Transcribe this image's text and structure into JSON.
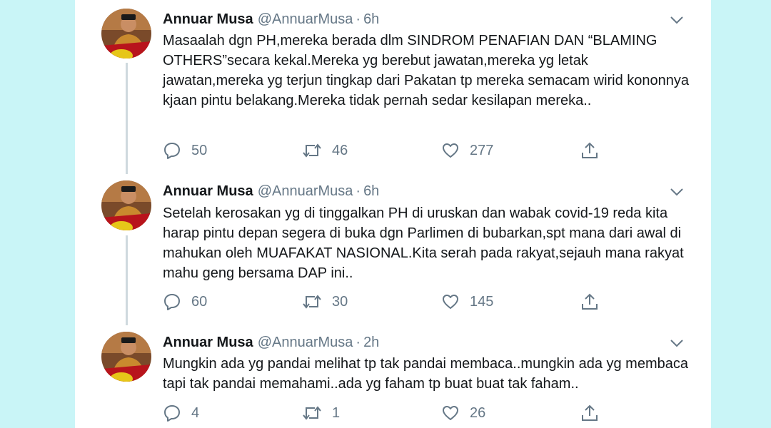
{
  "tweets": [
    {
      "name": "Annuar Musa",
      "handle": "@AnnuarMusa",
      "time": "6h",
      "text": "Masaalah dgn PH,mereka berada dlm SINDROM PENAFIAN DAN “BLAMING OTHERS”secara kekal.Mereka yg berebut jawatan,mereka yg letak jawatan,mereka yg terjun tingkap dari Pakatan tp mereka semacam wirid kononnya kjaan pintu belakang.Mereka tidak pernah sedar kesilapan mereka..",
      "replies": "50",
      "retweets": "46",
      "likes": "277"
    },
    {
      "name": "Annuar Musa",
      "handle": "@AnnuarMusa",
      "time": "6h",
      "text": "Setelah kerosakan yg di tinggalkan PH di uruskan dan wabak covid-19 reda kita harap pintu depan segera di buka dgn Parlimen di bubarkan,spt mana dari awal di mahukan oleh MUAFAKAT NASIONAL.Kita serah pada rakyat,sejauh mana rakyat mahu geng bersama DAP ini..",
      "replies": "60",
      "retweets": "30",
      "likes": "145"
    },
    {
      "name": "Annuar Musa",
      "handle": "@AnnuarMusa",
      "time": "2h",
      "text": "Mungkin ada yg pandai melihat tp tak pandai membaca..mungkin ada yg membaca tapi tak pandai memahami..ada yg faham tp buat buat tak faham..",
      "replies": "4",
      "retweets": "1",
      "likes": "26"
    }
  ],
  "separator": "·",
  "icons": {
    "reply": "reply-icon",
    "retweet": "retweet-icon",
    "like": "like-icon",
    "share": "share-icon",
    "caret": "chevron-down-icon"
  },
  "colors": {
    "background": "#c9f5f7",
    "text": "#14171a",
    "secondary": "#657786",
    "thread_line": "#cfd9de"
  }
}
